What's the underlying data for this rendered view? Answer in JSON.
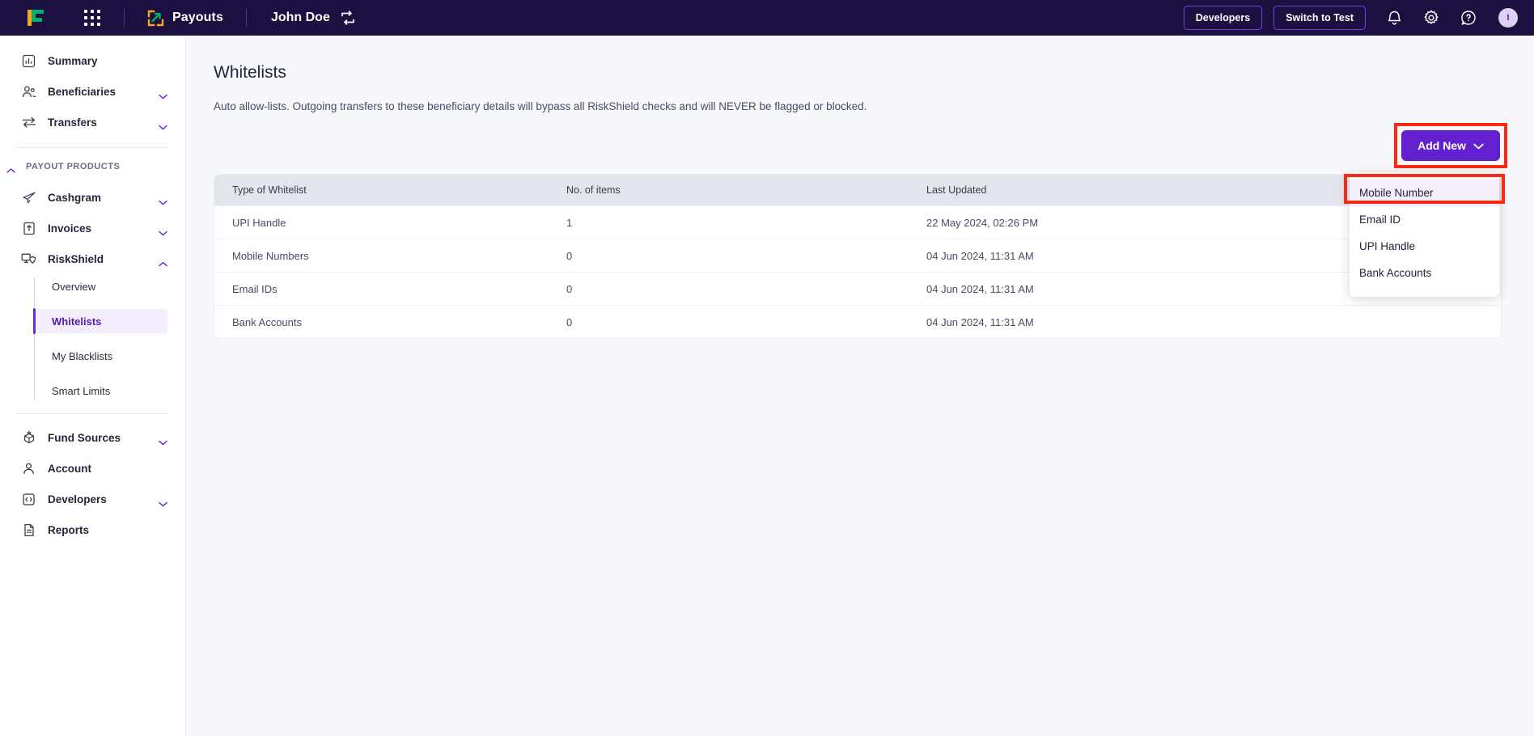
{
  "topbar": {
    "brand_icon": "cashfree-logo",
    "apps_icon": "app-grid-icon",
    "product_icon": "payouts-icon",
    "product_label": "Payouts",
    "account_name": "John Doe",
    "switch_account_icon": "swap-icon",
    "developers_label": "Developers",
    "switch_to_test_label": "Switch to Test",
    "notification_icon": "bell-icon",
    "settings_icon": "gear-icon",
    "help_icon": "help-icon",
    "avatar_initial": "I",
    "bg_color": "#1b1040",
    "accent_color": "#7c3aed"
  },
  "sidebar": {
    "items": [
      {
        "label": "Summary",
        "icon": "chart-icon",
        "expandable": false
      },
      {
        "label": "Beneficiaries",
        "icon": "users-icon",
        "expandable": true
      },
      {
        "label": "Transfers",
        "icon": "transfers-icon",
        "expandable": true
      }
    ],
    "section": {
      "title": "PAYOUT PRODUCTS"
    },
    "products": [
      {
        "label": "Cashgram",
        "icon": "send-icon",
        "expandable": true
      },
      {
        "label": "Invoices",
        "icon": "invoice-icon",
        "expandable": true
      },
      {
        "label": "RiskShield",
        "icon": "riskshield-icon",
        "expandable": true,
        "expanded": true
      }
    ],
    "riskshield_children": [
      {
        "label": "Overview",
        "active": false
      },
      {
        "label": "Whitelists",
        "active": true
      },
      {
        "label": "My Blacklists",
        "active": false
      },
      {
        "label": "Smart Limits",
        "active": false
      }
    ],
    "bottom_items": [
      {
        "label": "Fund Sources",
        "icon": "fund-sources-icon",
        "expandable": true
      },
      {
        "label": "Account",
        "icon": "person-icon",
        "expandable": false
      },
      {
        "label": "Developers",
        "icon": "code-icon",
        "expandable": true
      },
      {
        "label": "Reports",
        "icon": "report-icon",
        "expandable": false
      }
    ],
    "active_bg": "#f3edfc",
    "active_color": "#4c1fae"
  },
  "main": {
    "page_title": "Whitelists",
    "page_description": "Auto allow-lists. Outgoing transfers to these beneficiary details will bypass all RiskShield checks and will NEVER be flagged or blocked.",
    "add_new_label": "Add New",
    "add_new_color": "#6320ce",
    "dropdown": {
      "items": [
        {
          "label": "Mobile Number",
          "highlighted": true
        },
        {
          "label": "Email ID",
          "highlighted": false
        },
        {
          "label": "UPI Handle",
          "highlighted": false
        },
        {
          "label": "Bank Accounts",
          "highlighted": false
        }
      ]
    },
    "annotation_color": "#f92a13",
    "table": {
      "columns": [
        "Type of Whitelist",
        "No. of items",
        "Last Updated"
      ],
      "rows": [
        {
          "type": "UPI Handle",
          "items": "1",
          "updated": "22 May 2024, 02:26 PM"
        },
        {
          "type": "Mobile Numbers",
          "items": "0",
          "updated": "04 Jun 2024, 11:31 AM"
        },
        {
          "type": "Email IDs",
          "items": "0",
          "updated": "04 Jun 2024, 11:31 AM"
        },
        {
          "type": "Bank Accounts",
          "items": "0",
          "updated": "04 Jun 2024, 11:31 AM"
        }
      ]
    }
  }
}
